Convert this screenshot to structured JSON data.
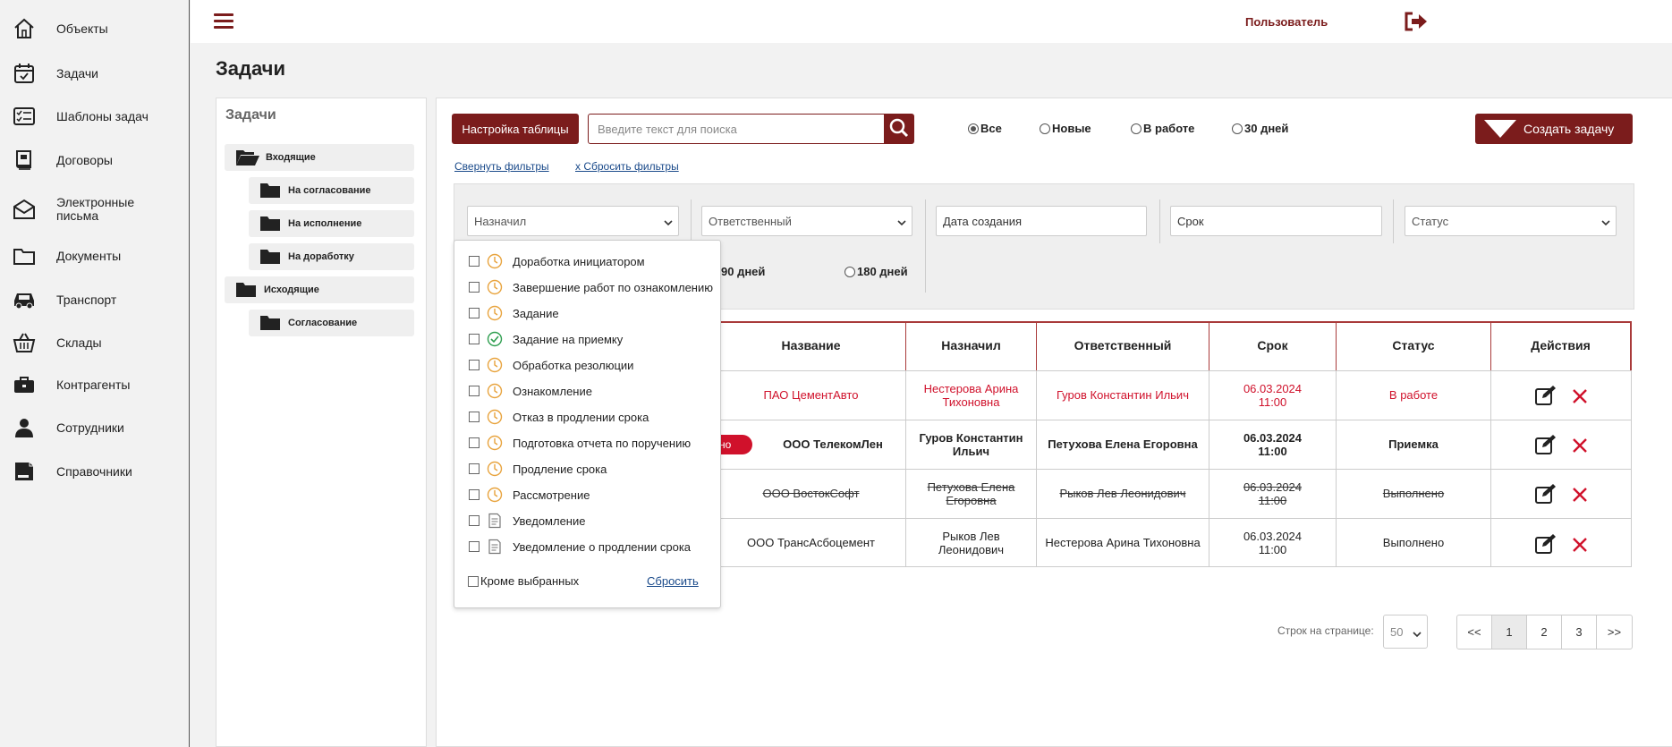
{
  "sidebar": {
    "items": [
      {
        "label": "Объекты",
        "icon": "home-icon"
      },
      {
        "label": "Задачи",
        "icon": "calendar-check-icon"
      },
      {
        "label": "Шаблоны задач",
        "icon": "checklist-icon"
      },
      {
        "label": "Договоры",
        "icon": "contract-book-icon"
      },
      {
        "label": "Электронные письма",
        "icon": "envelope-icon"
      },
      {
        "label": "Документы",
        "icon": "folder-icon"
      },
      {
        "label": "Транспорт",
        "icon": "car-icon"
      },
      {
        "label": "Склады",
        "icon": "basket-icon"
      },
      {
        "label": "Контрагенты",
        "icon": "briefcase-icon"
      },
      {
        "label": "Сотрудники",
        "icon": "person-icon"
      },
      {
        "label": "Справочники",
        "icon": "reference-book-icon"
      }
    ]
  },
  "topbar": {
    "user_label": "Пользователь"
  },
  "page_title": "Задачи",
  "tree": {
    "title": "Задачи",
    "items": [
      {
        "label": "Входящие",
        "open": true
      },
      {
        "label": "На согласование"
      },
      {
        "label": "На исполнение"
      },
      {
        "label": "На доработку"
      },
      {
        "label": "Исходящие"
      },
      {
        "label": "Согласование"
      }
    ]
  },
  "toolbar": {
    "settings_label": "Настройка таблицы",
    "search_placeholder": "Введите текст для поиска",
    "create_label": "Создать задачу",
    "radios": [
      {
        "label": "Все",
        "checked": true
      },
      {
        "label": "Новые",
        "checked": false
      },
      {
        "label": "В работе",
        "checked": false
      },
      {
        "label": "30 дней",
        "checked": false
      }
    ],
    "collapse_filters": "Свернуть фильтры",
    "reset_filters": "х Сбросить фильтры"
  },
  "filters": {
    "assigned_by": "Назначил",
    "responsible": "Ответственный",
    "created_date": "Дата создания",
    "deadline": "Срок",
    "status": "Статус",
    "period_partial": "90 дней",
    "period_180": "180 дней"
  },
  "table": {
    "headers": [
      "Название",
      "Назначил",
      "Ответственный",
      "Срок",
      "Статус",
      "Действия"
    ],
    "badge": "но",
    "rows": [
      {
        "name": "ПАО ЦементАвто",
        "assigned_by": "Нестерова Арина Тихоновна",
        "responsible": "Гуров Константин Ильич",
        "deadline_date": "06.03.2024",
        "deadline_time": "11:00",
        "status": "В работе",
        "style": "red"
      },
      {
        "name": "ООО ТелекомЛен",
        "assigned_by": "Гуров Константин Ильич",
        "responsible": "Петухова Елена Егоровна",
        "deadline_date": "06.03.2024",
        "deadline_time": "11:00",
        "status": "Приемка",
        "style": "bold"
      },
      {
        "name": "ООО ВостокСофт",
        "assigned_by": "Петухова Елена Егоровна",
        "responsible": "Рыков Лев Леонидович",
        "deadline_date": "06.03.2024",
        "deadline_time": "11:00",
        "status": "Выполнено",
        "style": "strike"
      },
      {
        "name": "ООО ТрансАсбоцемент",
        "assigned_by": "Рыков Лев Леонидович",
        "responsible": "Нестерова Арина Тихоновна",
        "deadline_date": "06.03.2024",
        "deadline_time": "11:00",
        "status": "Выполнено",
        "style": "normal"
      }
    ]
  },
  "type_dropdown": {
    "items": [
      {
        "label": "Доработка инициатором",
        "icon": "clock-icon"
      },
      {
        "label": "Завершение работ по ознакомлению",
        "icon": "clock-icon"
      },
      {
        "label": "Задание",
        "icon": "clock-icon"
      },
      {
        "label": "Задание на приемку",
        "icon": "check-circle-icon"
      },
      {
        "label": "Обработка резолюции",
        "icon": "clock-icon"
      },
      {
        "label": "Ознакомление",
        "icon": "clock-icon"
      },
      {
        "label": "Отказ в продлении срока",
        "icon": "clock-icon"
      },
      {
        "label": "Подготовка отчета по поручению",
        "icon": "clock-icon"
      },
      {
        "label": "Продление срока",
        "icon": "clock-icon"
      },
      {
        "label": "Рассмотрение",
        "icon": "clock-icon"
      },
      {
        "label": "Уведомление",
        "icon": "document-icon"
      },
      {
        "label": "Уведомление о продлении срока",
        "icon": "document-icon"
      }
    ],
    "except_label": "Кроме выбранных",
    "reset_label": "Сбросить"
  },
  "pagination": {
    "rows_label": "Строк на странице:",
    "rows_value": "50",
    "prev": "<<",
    "pages": [
      "1",
      "2",
      "3"
    ],
    "next": ">>",
    "current": "1"
  },
  "colors": {
    "accent": "#7b1c1c",
    "danger": "#d0112b",
    "clock": "#e8a33d",
    "check": "#2e9e4f"
  }
}
